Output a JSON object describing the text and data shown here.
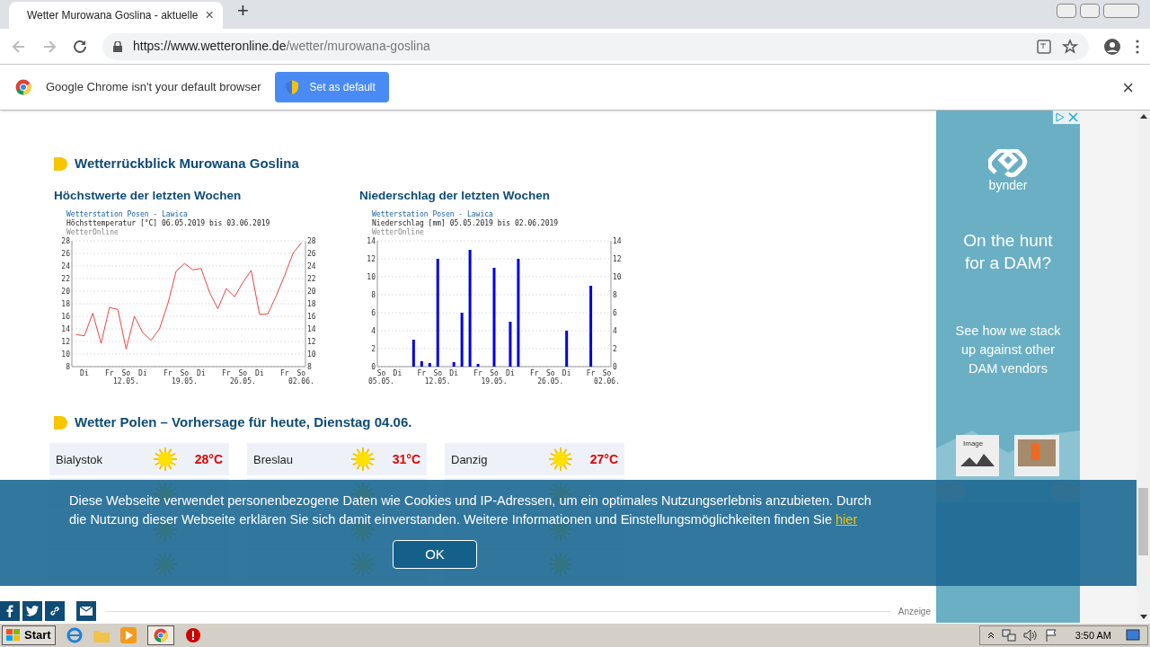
{
  "browser": {
    "tab": {
      "title": "Wetter Murowana Goslina - aktuelle",
      "close": "×"
    },
    "new_tab": "+",
    "url": {
      "host": "https://www.wetteronline.de",
      "path": "/wetter/murowana-goslina"
    },
    "infobar": {
      "message": "Google Chrome isn't your default browser",
      "button": "Set as default",
      "close": "×"
    }
  },
  "page": {
    "section_title": "Wetterrückblick Murowana Goslina",
    "charts": [
      {
        "heading": "Höchstwerte der letzten Wochen",
        "station": "Wetterstation Posen - Lawica",
        "source": "WetterOnline",
        "left_axis_labels": [
          "28",
          "26",
          "24",
          "22",
          "20",
          "18",
          "16",
          "14",
          "12",
          "10",
          "8"
        ],
        "right_axis_labels": [
          "28",
          "26",
          "24",
          "22",
          "20",
          "18",
          "16",
          "14",
          "12",
          "10",
          "8"
        ],
        "chart_data": {
          "type": "line",
          "title": "Höchsttemperatur [°C] 06.05.2019 bis 03.06.2019",
          "categories": [
            null,
            "Di",
            null,
            null,
            "Fr",
            null,
            "So 12.05.",
            null,
            "Di",
            null,
            null,
            "Fr",
            null,
            "So 19.05.",
            null,
            "Di",
            null,
            null,
            "Fr",
            null,
            "So 26.05.",
            null,
            "Di",
            null,
            null,
            "Fr",
            null,
            "So 02.06."
          ],
          "series": [
            {
              "color": "#e83030",
              "values": [
                13.1,
                12.9,
                16.5,
                11.7,
                17.4,
                17.1,
                10.8,
                16.0,
                13.4,
                12.2,
                14.0,
                18.0,
                23.2,
                24.4,
                23.4,
                23.6,
                19.8,
                17.2,
                20.4,
                19.1,
                21.4,
                23.3,
                16.3,
                16.4,
                19.3,
                22.5,
                26.0,
                27.7
              ]
            }
          ],
          "ylim": [
            8,
            28
          ],
          "yticks": [
            8,
            10,
            12,
            14,
            16,
            18,
            20,
            22,
            24,
            26,
            28
          ],
          "grid": true
        }
      },
      {
        "heading": "Niederschlag der letzten Wochen",
        "station": "Wetterstation Posen - Lawica",
        "source": "WetterOnline",
        "left_axis_labels": [
          "14",
          "12",
          "10",
          "8",
          "6",
          "4",
          "2",
          "0"
        ],
        "right_axis_labels": [
          "14",
          "12",
          "10",
          "8",
          "6",
          "4",
          "2",
          "0"
        ],
        "chart_data": {
          "type": "bar",
          "title": "Niederschlag [mm] 05.05.2019 bis 02.06.2019",
          "categories": [
            "So 05.05.",
            null,
            "Di",
            null,
            null,
            "Fr",
            null,
            "So 12.05.",
            null,
            "Di",
            null,
            null,
            "Fr",
            null,
            "So 19.05.",
            null,
            "Di",
            null,
            null,
            "Fr",
            null,
            "So 26.05.",
            null,
            "Di",
            null,
            null,
            "Fr",
            null,
            "So 02.06."
          ],
          "series": [
            {
              "color": "#0000e0",
              "values": [
                0,
                0,
                0,
                0,
                3,
                0.6,
                0.4,
                12,
                0,
                0.5,
                6,
                13,
                0.3,
                0,
                11,
                0,
                5,
                12,
                0,
                0,
                0,
                0,
                0,
                4,
                0,
                0,
                9,
                0,
                0
              ]
            }
          ],
          "ylim": [
            0,
            14
          ],
          "yticks": [
            0,
            2,
            4,
            6,
            8,
            10,
            12,
            14
          ],
          "grid": true
        }
      }
    ],
    "forecast_title": "Wetter Polen – Vorhersage für heute, Dienstag 04.06.",
    "forecast_rows": [
      [
        {
          "city": "Bialystok",
          "temp": "28°C"
        },
        {
          "city": "Breslau",
          "temp": "31°C"
        },
        {
          "city": "Danzig",
          "temp": "27°C"
        }
      ]
    ],
    "ad_label": "Anzeige"
  },
  "ad": {
    "brand": "bynder",
    "headline": "On the hunt for a DAM?",
    "body": "See how we stack up against other DAM vendors",
    "image_label": "Image"
  },
  "cookie": {
    "text": "Diese Webseite verwendet personenbezogene Daten wie Cookies und IP-Adressen, um ein optimales Nutzungserlebnis anzubieten. Durch die Nutzung dieser Webseite erklären Sie sich damit einverstanden. Weitere Informationen und Einstellungsmöglichkeiten finden Sie",
    "link": "hier",
    "button": "OK"
  },
  "taskbar": {
    "start": "Start",
    "time": "3:50 AM"
  }
}
